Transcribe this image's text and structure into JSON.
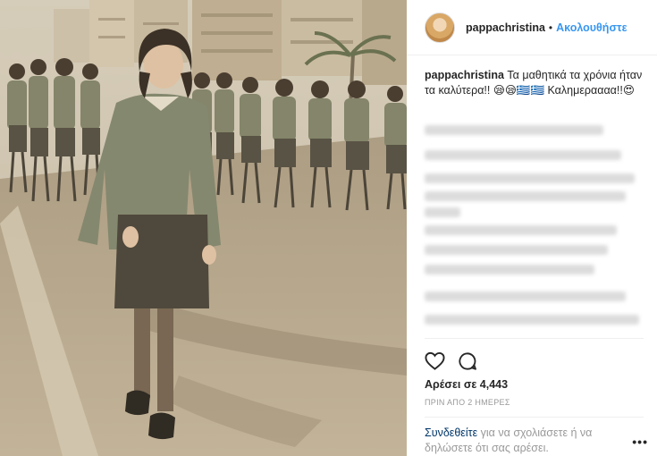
{
  "header": {
    "username": "pappachristina",
    "separator": "•",
    "follow_label": "Ακολουθήστε",
    "avatar_icon": "profile-avatar-icon"
  },
  "caption": {
    "username": "pappachristina",
    "text": "Τα μαθητικά τα χρόνια ήταν τα καλύτερα!! 😪😪🇬🇷🇬🇷 Καλημεραααα!!😍"
  },
  "actions": {
    "like_icon": "heart-icon",
    "comment_icon": "comment-icon"
  },
  "likes": {
    "text": "Αρέσει σε 4,443"
  },
  "timestamp": {
    "text": "ΠΡΙΝ ΑΠΟ 2 ΗΜΕΡΕΣ"
  },
  "footer": {
    "login_link": "Συνδεθείτε",
    "login_rest": "για να σχολιάσετε ή να δηλώσετε ότι σας αρέσει.",
    "more_label": "•••"
  },
  "colors": {
    "link_blue": "#3897f0",
    "login_dark_blue": "#003569",
    "text_dark": "#262626",
    "text_muted": "#999999",
    "divider": "#efefef"
  }
}
